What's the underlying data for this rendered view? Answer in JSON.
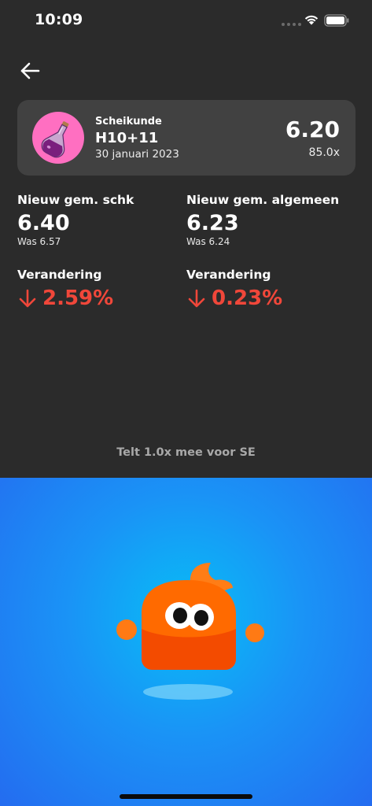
{
  "status_bar": {
    "time": "10:09"
  },
  "grade": {
    "subject": "Scheikunde",
    "title": "H10+11",
    "date": "30 januari 2023",
    "value": "6.20",
    "weight": "85.0x",
    "avatar_color": "#ff6fc1"
  },
  "stats": {
    "subject_avg": {
      "label": "Nieuw gem. schk",
      "value": "6.40",
      "was": "Was 6.57",
      "change_label": "Verandering",
      "change": "2.59%"
    },
    "overall_avg": {
      "label": "Nieuw gem. algemeen",
      "value": "6.23",
      "was": "Was 6.24",
      "change_label": "Verandering",
      "change": "0.23%"
    }
  },
  "note": "Telt 1.0x mee voor SE",
  "colors": {
    "background": "#2b2b2b",
    "card": "#414141",
    "negative": "#f0473a",
    "hero_center": "#08bdf5",
    "hero_edge": "#246cf0",
    "mascot": "#ff6a00"
  },
  "icons": [
    "arrow-left-icon",
    "flask-icon",
    "arrow-down-icon",
    "wifi-icon",
    "battery-icon"
  ]
}
